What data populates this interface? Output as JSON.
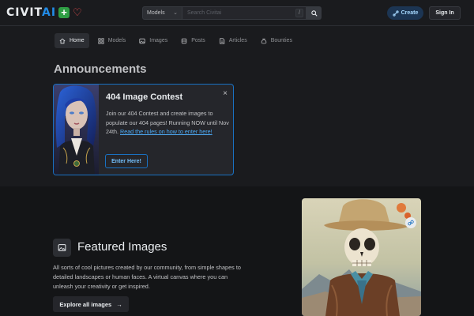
{
  "header": {
    "logo_text_a": "CIVIT",
    "logo_text_b": "AI",
    "logo_plus": "+",
    "logo_heart": "♡",
    "search": {
      "type_value": "Models",
      "placeholder": "Search Civitai",
      "shortcut": "/"
    },
    "create_label": "Create",
    "signin_label": "Sign In"
  },
  "nav": {
    "items": [
      {
        "label": "Home",
        "icon": "home-icon",
        "active": true
      },
      {
        "label": "Models",
        "icon": "grid-icon"
      },
      {
        "label": "Images",
        "icon": "image-icon"
      },
      {
        "label": "Posts",
        "icon": "posts-icon"
      },
      {
        "label": "Articles",
        "icon": "article-icon"
      },
      {
        "label": "Bounties",
        "icon": "moneybag-icon"
      }
    ]
  },
  "announcements": {
    "title": "Announcements",
    "card": {
      "heading": "404 Image Contest",
      "close": "×",
      "body_text": "Join our 404 Contest and create images to populate our 404 pages! Running NOW until Nov 24th.",
      "link_text": "Read the rules on how to enter here!",
      "button": "Enter Here!"
    }
  },
  "featured": {
    "title": "Featured Images",
    "description": "All sorts of cool pictures created by our community, from simple shapes to detailed landscapes or human faces. A virtual canvas where you can unleash your creativity or get inspired.",
    "button": "Explore all images",
    "button_arrow": "→"
  },
  "colors": {
    "background": "#1a1b1e",
    "accent_blue": "#228be6",
    "create_bg": "#1c3553",
    "plus_green": "#2f9e44",
    "heart_red": "#fa5252"
  }
}
